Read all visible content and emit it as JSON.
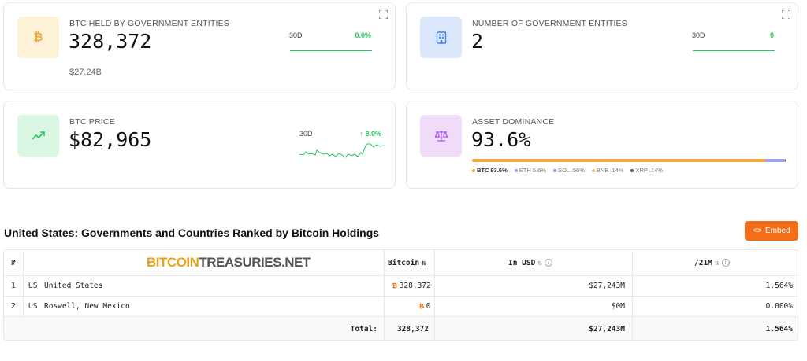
{
  "cards": {
    "held": {
      "label": "BTC HELD BY GOVERNMENT ENTITIES",
      "value": "328,372",
      "usd": "$27.24B",
      "range": "30D",
      "change": "0.0%",
      "icon": "bitcoin-icon"
    },
    "entities": {
      "label": "NUMBER OF GOVERNMENT ENTITIES",
      "value": "2",
      "range": "30D",
      "change": "0",
      "icon": "building-icon"
    },
    "price": {
      "label": "BTC PRICE",
      "value": "$82,965",
      "range": "30D",
      "change": "↑ 8.0%",
      "icon": "trending-up-icon"
    },
    "dominance": {
      "label": "ASSET DOMINANCE",
      "value": "93.6%",
      "icon": "scale-icon",
      "bar": [
        {
          "name": "BTC",
          "share": 93.6,
          "color": "#f0a93a"
        },
        {
          "name": "ETH",
          "share": 5.6,
          "color": "#9ca3f0"
        },
        {
          "name": "SOL",
          "share": 0.56,
          "color": "#b58cf0"
        },
        {
          "name": "BNB",
          "share": 0.14,
          "color": "#f5c26b"
        },
        {
          "name": "XRP",
          "share": 0.14,
          "color": "#555555"
        }
      ],
      "legend": [
        "BTC 93.6%",
        "ETH 5.6%",
        "SOL .56%",
        "BNB .14%",
        "XRP .14%"
      ]
    }
  },
  "section": {
    "title": "United States: Governments and Countries Ranked by Bitcoin Holdings",
    "embed_label": "Embed"
  },
  "table": {
    "headers": {
      "rank": "#",
      "bitcoin": "Bitcoin",
      "usd": "In USD",
      "share": "/21M"
    },
    "watermark": {
      "left": "BITCOIN",
      "mid": "TREASURIES",
      "right": ".NET"
    },
    "rows": [
      {
        "rank": "1",
        "country": "US",
        "name": "United States",
        "btc": "328,372",
        "usd": "$27,243M",
        "share": "1.564%"
      },
      {
        "rank": "2",
        "country": "US",
        "name": "Roswell, New Mexico",
        "btc": "0",
        "usd": "$0M",
        "share": "0.000%"
      }
    ],
    "total": {
      "label": "Total:",
      "btc": "328,372",
      "usd": "$27,243M",
      "share": "1.564%"
    }
  },
  "colors": {
    "accent": "#f36e1a",
    "positive": "#22c55e",
    "bitcoin": "#e9a21a"
  }
}
